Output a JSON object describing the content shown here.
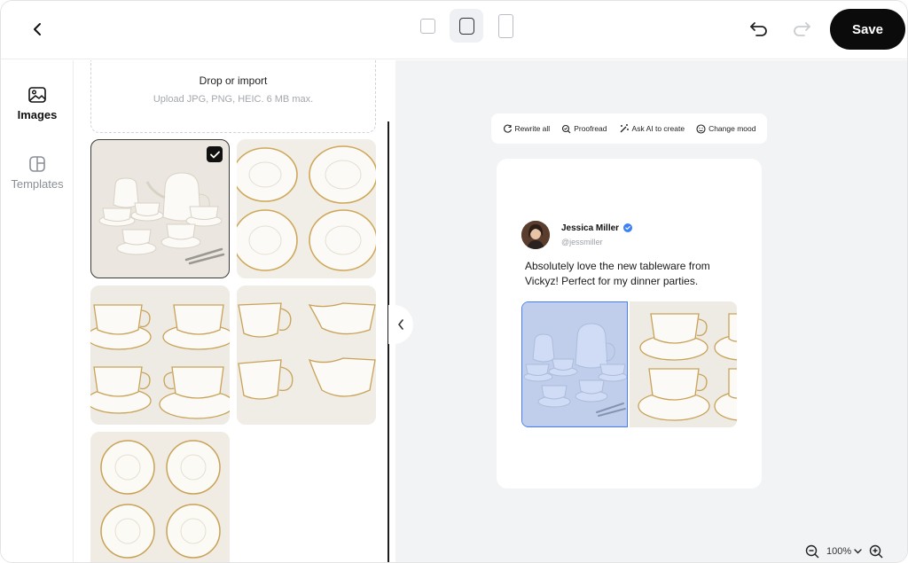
{
  "toolbar": {
    "save_label": "Save",
    "back_icon": "chevron-left-icon",
    "undo_icon": "undo-icon",
    "redo_icon": "redo-icon",
    "ratios": [
      {
        "name": "square",
        "selected": false
      },
      {
        "name": "rounded-square",
        "selected": true
      },
      {
        "name": "portrait",
        "selected": false
      }
    ]
  },
  "sidebar": {
    "items": [
      {
        "label": "Images",
        "icon": "image-icon",
        "active": true
      },
      {
        "label": "Templates",
        "icon": "template-icon",
        "active": false
      }
    ]
  },
  "upload": {
    "title": "Drop or import",
    "subtitle": "Upload JPG, PNG, HEIC. 6 MB max."
  },
  "gallery": {
    "images": [
      {
        "subject": "tea-set",
        "selected": true
      },
      {
        "subject": "saucers",
        "selected": false
      },
      {
        "subject": "cups-and-saucers",
        "selected": false
      },
      {
        "subject": "cream-pitchers",
        "selected": false
      },
      {
        "subject": "saucers-top-view",
        "selected": false
      }
    ]
  },
  "ai_tools": {
    "rewrite_all": "Rewrite all",
    "proofread": "Proofread",
    "ask_ai": "Ask AI to create",
    "change_mood": "Change mood"
  },
  "post": {
    "author_name": "Jessica Miller",
    "handle": "@jessmiller",
    "verified": true,
    "text": "Absolutely love the new tableware from Vickyz! Perfect for my dinner parties."
  },
  "zoom": {
    "level": "100%"
  },
  "colors": {
    "accent": "#4a7ee8",
    "save_bg": "#0b0b0b",
    "canvas_bg": "#f2f3f5",
    "verified": "#3b82f6"
  }
}
